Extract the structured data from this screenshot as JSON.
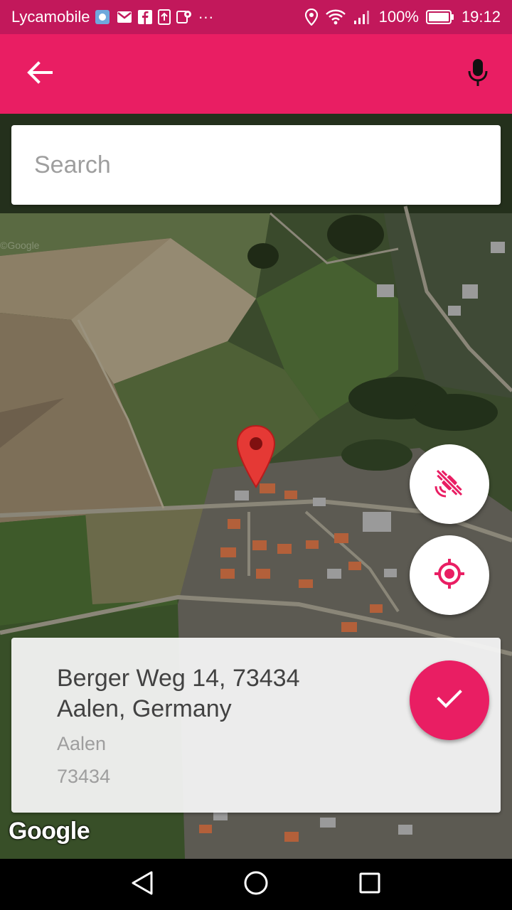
{
  "status_bar": {
    "carrier": "Lycamobile",
    "more": "···",
    "battery": "100%",
    "time": "19:12"
  },
  "app_bar": {
    "back_icon": "arrow-back-icon",
    "mic_icon": "microphone-icon",
    "color": "#e91e63"
  },
  "search": {
    "placeholder": "Search",
    "value": ""
  },
  "map": {
    "type": "satellite",
    "attribution": "Google",
    "satellite_toggle_icon": "satellite-off-icon",
    "locate_icon": "my-location-icon",
    "marker_icon": "map-pin-icon"
  },
  "address": {
    "line1": "Berger Weg 14, 73434",
    "line2": "Aalen, Germany",
    "city": "Aalen",
    "postal_code": "73434"
  },
  "confirm": {
    "icon": "check-icon"
  },
  "nav": {
    "back_icon": "nav-back-icon",
    "home_icon": "nav-home-icon",
    "recents_icon": "nav-recents-icon"
  },
  "colors": {
    "accent": "#e91e63",
    "status_bar": "#c2185b"
  }
}
